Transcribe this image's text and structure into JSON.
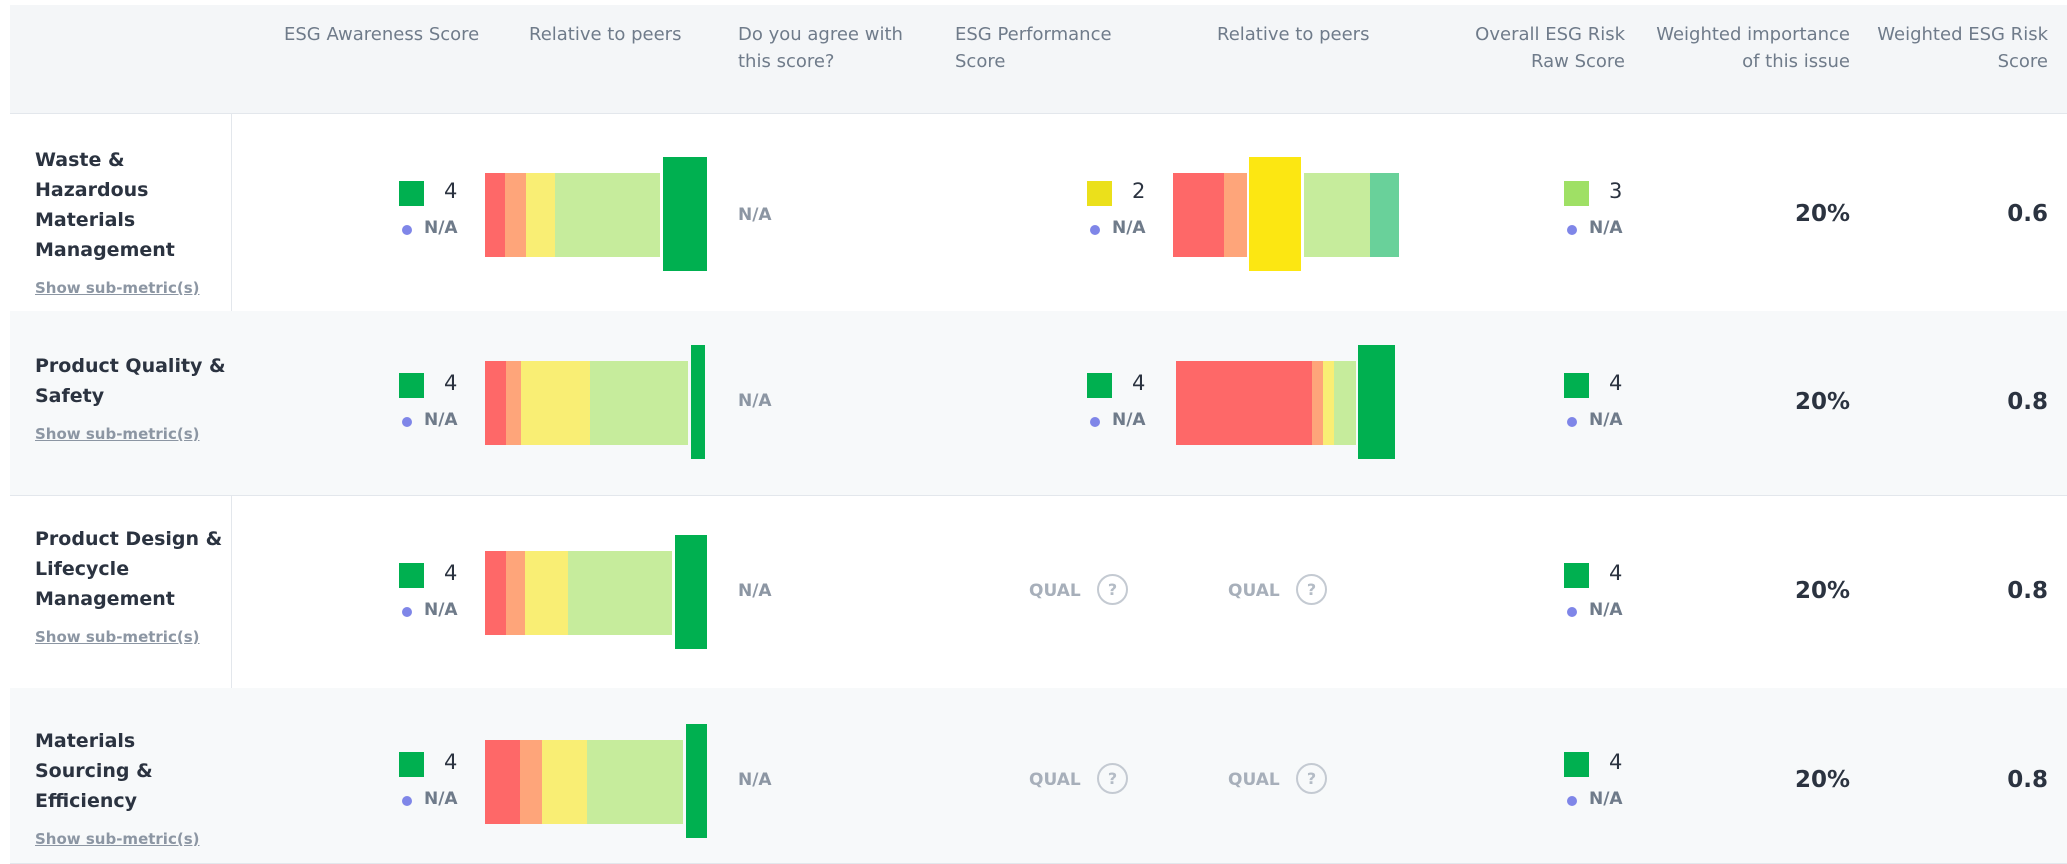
{
  "colors": {
    "peer_red": "#fe6868",
    "peer_orange": "#fea57a",
    "peer_yellow": "#f9ee74",
    "peer_lightgreen": "#c6ec9c",
    "peer_teal": "#69d19a",
    "score_green": "#00b050",
    "score_yellow": "#ebe01b",
    "score_lightgreen": "#9fe065",
    "na_dot": "#7f86e8"
  },
  "headers": {
    "esg_awareness": "ESG Awareness Score",
    "relative_1": "Relative to peers",
    "agree": "Do you agree with this score?",
    "esg_performance": "ESG Performance Score",
    "relative_2": "Relative to peers",
    "raw_score": "Overall ESG Risk Raw Score",
    "weighted_importance": "Weighted importance of this issue",
    "weighted_esg": "Weighted ESG Risk Score"
  },
  "rows": [
    {
      "issue": "Waste & Hazardous Materials Management",
      "sub_link": "Show sub-metric(s)",
      "awareness": {
        "value": "4",
        "color": "#00b050",
        "na": "N/A"
      },
      "agree": "N/A",
      "performance": {
        "value": "2",
        "color": "#ebe01b",
        "na": "N/A"
      },
      "raw": {
        "value": "3",
        "color": "#9fe065",
        "na": "N/A"
      },
      "importance": "20%",
      "weighted": "0.6"
    },
    {
      "issue": "Product Quality & Safety",
      "sub_link": "Show sub-metric(s)",
      "awareness": {
        "value": "4",
        "color": "#00b050",
        "na": "N/A"
      },
      "agree": "N/A",
      "performance": {
        "value": "4",
        "color": "#00b050",
        "na": "N/A"
      },
      "raw": {
        "value": "4",
        "color": "#00b050",
        "na": "N/A"
      },
      "importance": "20%",
      "weighted": "0.8"
    },
    {
      "issue": "Product Design & Lifecycle Management",
      "sub_link": "Show sub-metric(s)",
      "awareness": {
        "value": "4",
        "color": "#00b050",
        "na": "N/A"
      },
      "agree": "N/A",
      "performance_qual": "QUAL",
      "relative_qual": "QUAL",
      "raw": {
        "value": "4",
        "color": "#00b050",
        "na": "N/A"
      },
      "importance": "20%",
      "weighted": "0.8"
    },
    {
      "issue": "Materials Sourcing & Efficiency",
      "sub_link": "Show sub-metric(s)",
      "awareness": {
        "value": "4",
        "color": "#00b050",
        "na": "N/A"
      },
      "agree": "N/A",
      "performance_qual": "QUAL",
      "relative_qual": "QUAL",
      "raw": {
        "value": "4",
        "color": "#00b050",
        "na": "N/A"
      },
      "importance": "20%",
      "weighted": "0.8"
    }
  ],
  "qmark_glyph": "?"
}
